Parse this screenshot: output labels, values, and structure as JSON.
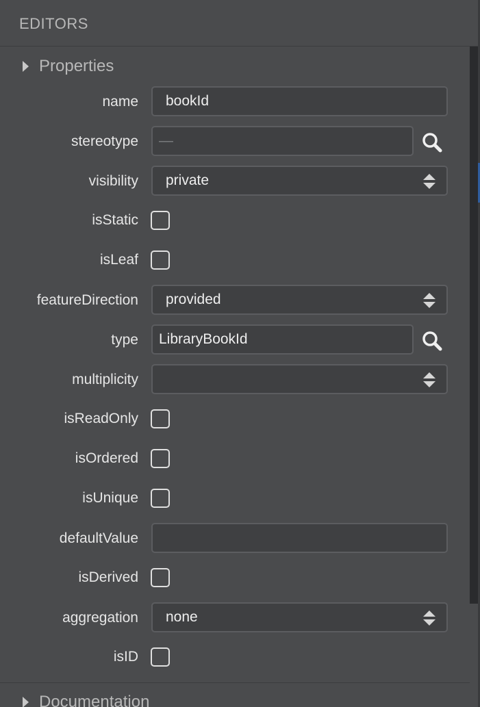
{
  "panel": {
    "title": "EDITORS"
  },
  "sections": {
    "properties": "Properties",
    "documentation": "Documentation"
  },
  "fields": {
    "name": {
      "label": "name",
      "value": "bookId"
    },
    "stereotype": {
      "label": "stereotype",
      "placeholder": "—"
    },
    "visibility": {
      "label": "visibility",
      "value": "private"
    },
    "isStatic": {
      "label": "isStatic",
      "checked": false
    },
    "isLeaf": {
      "label": "isLeaf",
      "checked": false
    },
    "featureDirection": {
      "label": "featureDirection",
      "value": "provided"
    },
    "type": {
      "label": "type",
      "value": "LibraryBookId"
    },
    "multiplicity": {
      "label": "multiplicity",
      "value": ""
    },
    "isReadOnly": {
      "label": "isReadOnly",
      "checked": false
    },
    "isOrdered": {
      "label": "isOrdered",
      "checked": false
    },
    "isUnique": {
      "label": "isUnique",
      "checked": false
    },
    "defaultValue": {
      "label": "defaultValue",
      "value": ""
    },
    "isDerived": {
      "label": "isDerived",
      "checked": false
    },
    "aggregation": {
      "label": "aggregation",
      "value": "none"
    },
    "isID": {
      "label": "isID",
      "checked": false
    }
  },
  "icons": {
    "search": "search-icon",
    "expand": "triangle-right-icon"
  },
  "colors": {
    "background": "#4a4b4d",
    "field_bg": "#3f4042",
    "field_border": "#5c5d60",
    "text": "#e6e6e6",
    "muted_text": "#b8b8b8"
  }
}
